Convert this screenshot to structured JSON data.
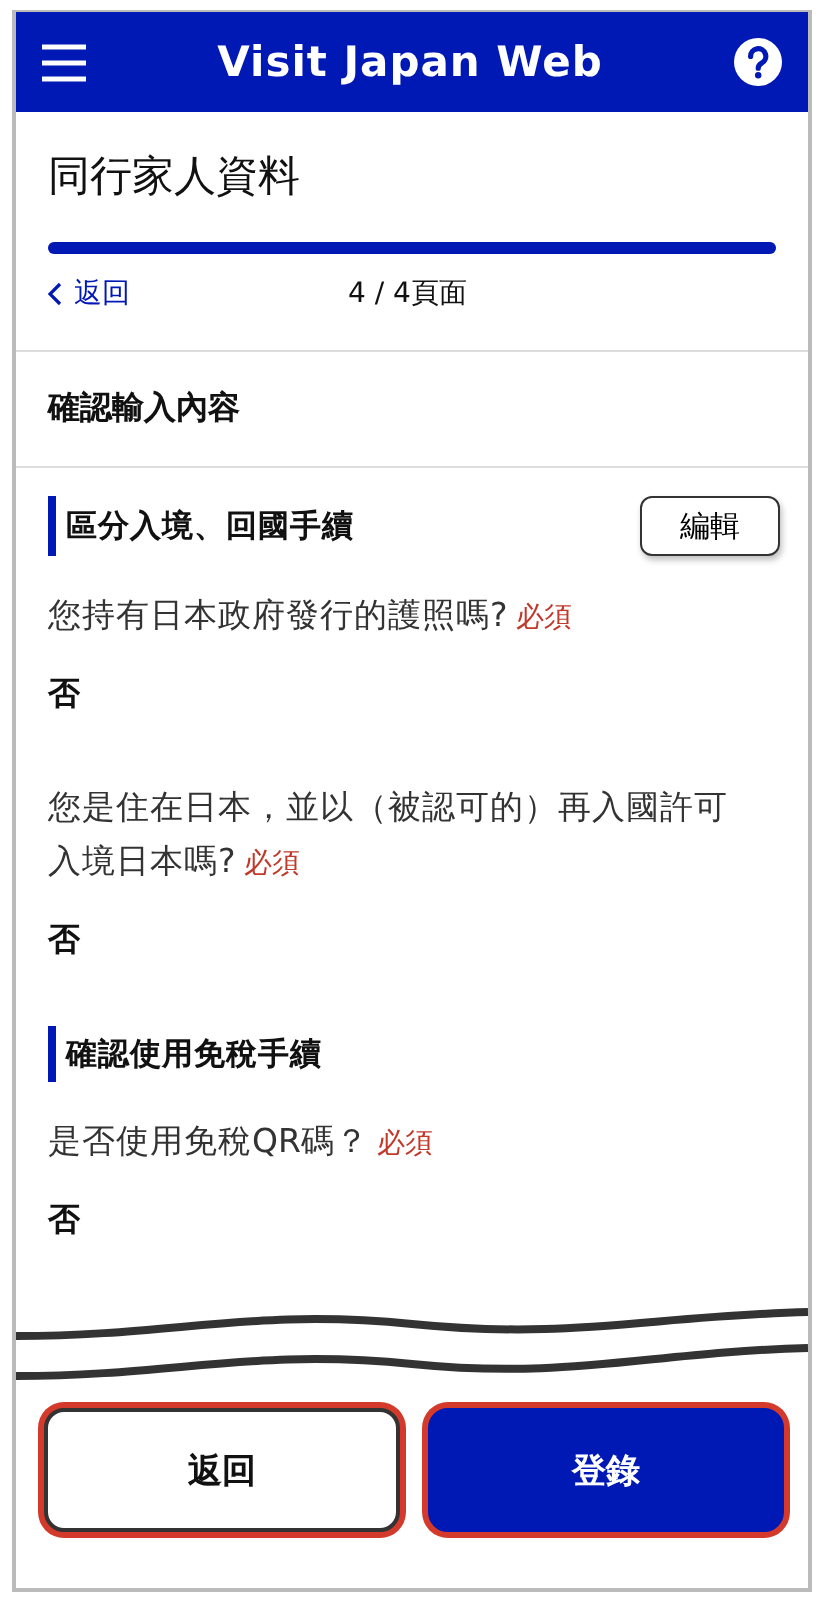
{
  "header": {
    "title": "Visit Japan Web"
  },
  "page_title": "同行家人資料",
  "progress": {
    "level": 1
  },
  "nav": {
    "back": "返回",
    "page_count": "4 / 4頁面"
  },
  "confirm_heading": "確認輸入內容",
  "sections": [
    {
      "title": "區分入境、回國手續",
      "edit_button": "編輯",
      "questions": [
        {
          "text": "您持有日本政府發行的護照嗎?",
          "required": "必須",
          "answer": "否"
        },
        {
          "text": "您是住在日本，並以（被認可的）再入國許可入境日本嗎?",
          "required": "必須",
          "answer": "否"
        }
      ]
    },
    {
      "title": "確認使用免稅手續",
      "questions": [
        {
          "text": "是否使用免稅QR碼？",
          "required": "必須",
          "answer": "否"
        }
      ]
    }
  ],
  "buttons": [
    {
      "label": "返回",
      "kind": "secondary",
      "highlighted": true
    },
    {
      "label": "登錄",
      "kind": "primary",
      "highlighted": true
    }
  ]
}
